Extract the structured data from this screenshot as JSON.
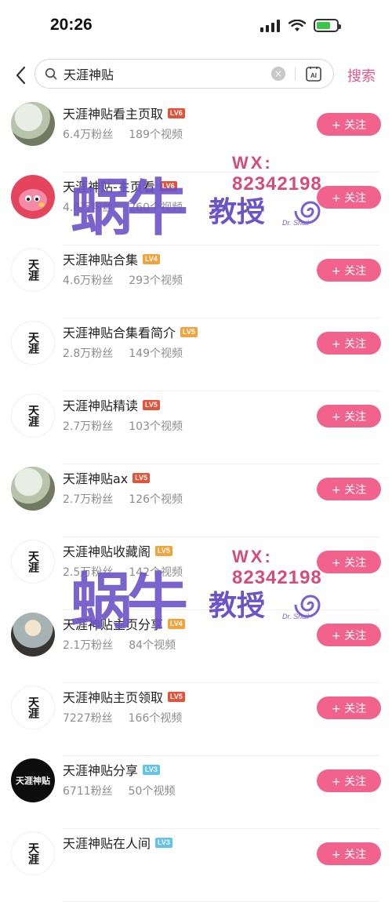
{
  "status_bar": {
    "time": "20:26"
  },
  "search": {
    "query": "天涯神贴",
    "search_button": "搜索",
    "clear_icon": "×"
  },
  "watermark": {
    "main": "蜗牛",
    "wx": "WX:",
    "number": "82342198",
    "sub": "教授",
    "brand": "Dr. Snail"
  },
  "results": [
    {
      "title": "天涯神贴看主页取",
      "level": "LV6",
      "level_color": "red",
      "fans": "6.4万粉丝",
      "videos": "189个视频",
      "avatar": "mountain",
      "avatar_text": "",
      "follow": "+ 关注"
    },
    {
      "title": "天涯神贴-主页看",
      "level": "LV6",
      "level_color": "red",
      "fans": "4.8万粉丝",
      "videos": "260个视频",
      "avatar": "pig",
      "avatar_text": "",
      "follow": "+ 关注"
    },
    {
      "title": "天涯神贴合集",
      "level": "LV4",
      "level_color": "orange",
      "fans": "4.6万粉丝",
      "videos": "293个视频",
      "avatar": "white",
      "avatar_text": "天涯",
      "follow": "+ 关注"
    },
    {
      "title": "天涯神贴合集看简介",
      "level": "LV5",
      "level_color": "orange",
      "fans": "2.8万粉丝",
      "videos": "149个视频",
      "avatar": "white",
      "avatar_text": "天涯",
      "follow": "+ 关注"
    },
    {
      "title": "天涯神贴精读",
      "level": "LV5",
      "level_color": "red",
      "fans": "2.7万粉丝",
      "videos": "103个视频",
      "avatar": "white",
      "avatar_text": "天涯",
      "follow": "+ 关注"
    },
    {
      "title": "天涯神贴ax",
      "level": "LV5",
      "level_color": "red",
      "fans": "2.7万粉丝",
      "videos": "126个视频",
      "avatar": "mountain",
      "avatar_text": "",
      "follow": "+ 关注"
    },
    {
      "title": "天涯神贴收藏阁",
      "level": "LV5",
      "level_color": "orange",
      "fans": "2.5万粉丝",
      "videos": "142个视频",
      "avatar": "white",
      "avatar_text": "天涯",
      "follow": "+ 关注"
    },
    {
      "title": "天涯神贴主页分享",
      "level": "LV4",
      "level_color": "orange",
      "fans": "2.1万粉丝",
      "videos": "84个视频",
      "avatar": "sunset",
      "avatar_text": "",
      "follow": "+ 关注"
    },
    {
      "title": "天涯神贴主页领取",
      "level": "LV5",
      "level_color": "red",
      "fans": "7227粉丝",
      "videos": "166个视频",
      "avatar": "white",
      "avatar_text": "天涯",
      "follow": "+ 关注"
    },
    {
      "title": "天涯神贴分享",
      "level": "LV3",
      "level_color": "blue",
      "fans": "6711粉丝",
      "videos": "50个视频",
      "avatar": "black",
      "avatar_text": "天涯神贴",
      "follow": "+ 关注"
    },
    {
      "title": "天涯神贴在人间",
      "level": "LV3",
      "level_color": "blue",
      "fans": "",
      "videos": "",
      "avatar": "white",
      "avatar_text": "天涯",
      "follow": "+ 关注"
    }
  ]
}
